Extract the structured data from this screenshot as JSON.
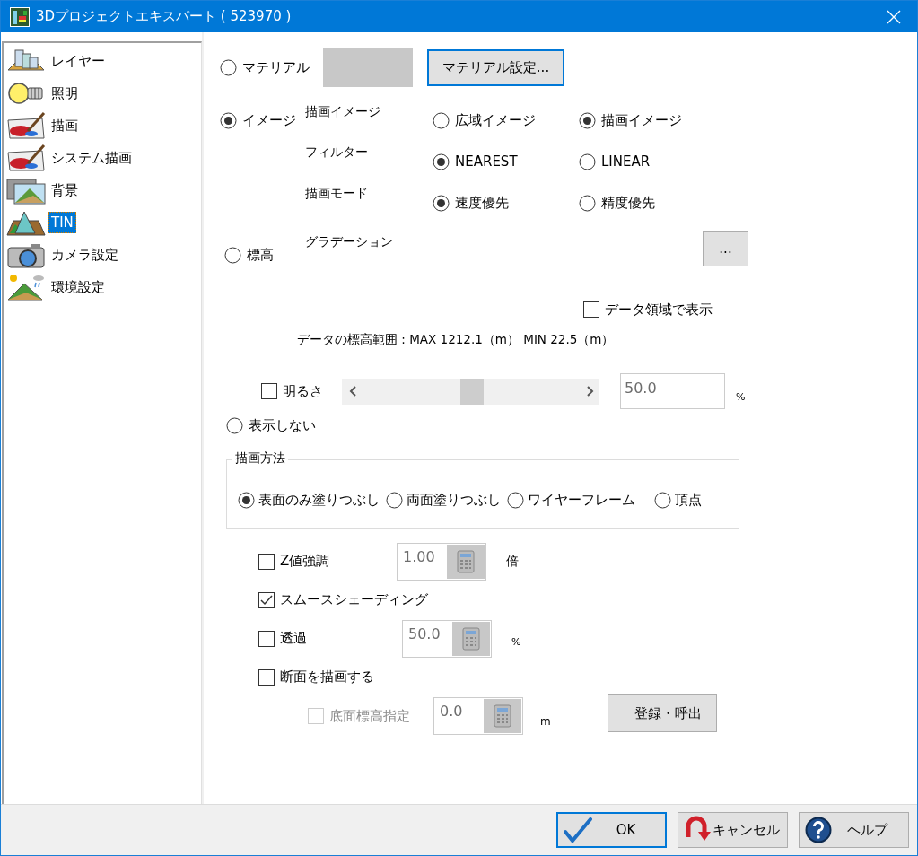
{
  "window": {
    "title": "3Dプロジェクトエキスパート ( 523970 )"
  },
  "sidebar": {
    "items": [
      {
        "kind": "layers",
        "label": "レイヤー",
        "selected": false
      },
      {
        "kind": "bulb",
        "label": "照明",
        "selected": false
      },
      {
        "kind": "paint",
        "label": "描画",
        "selected": false
      },
      {
        "kind": "paint",
        "label": "システム描画",
        "selected": false
      },
      {
        "kind": "background",
        "label": "背景",
        "selected": false
      },
      {
        "kind": "tin",
        "label": "TIN",
        "selected": true
      },
      {
        "kind": "camera",
        "label": "カメラ設定",
        "selected": false
      },
      {
        "kind": "environment",
        "label": "環境設定",
        "selected": false
      }
    ]
  },
  "material": {
    "label": "マテリアル",
    "selected": false,
    "button": "マテリアル設定..."
  },
  "image": {
    "label": "イメージ",
    "selected": true,
    "settings": [
      {
        "label": "描画イメージ",
        "choices": [
          {
            "label": "広域イメージ",
            "selected": false
          },
          {
            "label": "描画イメージ",
            "selected": true
          }
        ]
      },
      {
        "label": "フィルター",
        "choices": [
          {
            "label": "NEAREST",
            "selected": true
          },
          {
            "label": "LINEAR",
            "selected": false
          }
        ]
      },
      {
        "label": "描画モード",
        "choices": [
          {
            "label": "速度優先",
            "selected": true
          },
          {
            "label": "精度優先",
            "selected": false
          }
        ]
      }
    ]
  },
  "elevation": {
    "label": "標高",
    "selected": false,
    "gradation_label": "グラデーション",
    "gradation_button": "...",
    "data_area": {
      "label": "データ領域で表示",
      "checked": false
    },
    "range_text": "データの標高範囲 : MAX 1212.1（m） MIN 22.5（m）",
    "brightness": {
      "label": "明るさ",
      "checked": false,
      "level": 0.5,
      "value": "50.0",
      "unit": "%"
    }
  },
  "hide": {
    "label": "表示しない",
    "selected": false
  },
  "draw_method": {
    "title": "描画方法",
    "options": [
      {
        "label": "表面のみ塗りつぶし",
        "selected": true
      },
      {
        "label": "両面塗りつぶし",
        "selected": false
      },
      {
        "label": "ワイヤーフレーム",
        "selected": false
      },
      {
        "label": "頂点",
        "selected": false
      }
    ]
  },
  "options": [
    {
      "kind": "calc",
      "label": "Z値強調",
      "checked": false,
      "value": "1.00",
      "unit": "倍"
    },
    {
      "kind": "check",
      "label": "スムースシェーディング",
      "checked": true
    },
    {
      "kind": "calc",
      "label": "透過",
      "checked": false,
      "value": "50.0",
      "unit": "%"
    },
    {
      "kind": "check",
      "label": "断面を描画する",
      "checked": false
    }
  ],
  "base_elevation": {
    "label": "底面標高指定",
    "checked": false,
    "disabled": true,
    "value": "0.0",
    "unit": "m",
    "button": "登録・呼出"
  },
  "buttons": [
    {
      "kind": "ok",
      "label": "OK"
    },
    {
      "kind": "cancel",
      "label": "キャンセル"
    },
    {
      "kind": "help",
      "label": "ヘルプ"
    }
  ]
}
